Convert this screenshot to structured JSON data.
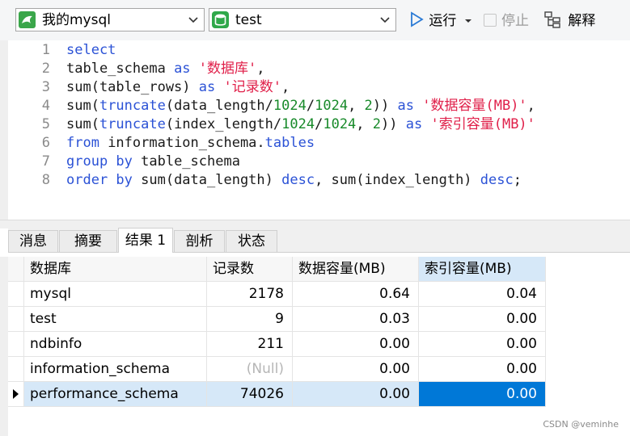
{
  "toolbar": {
    "connection": "我的mysql",
    "database": "test",
    "run_label": "运行",
    "stop_label": "停止",
    "explain_label": "解释"
  },
  "editor": {
    "line_numbers": [
      "1",
      "2",
      "3",
      "4",
      "5",
      "6",
      "7",
      "8"
    ],
    "lines": [
      [
        {
          "t": "select",
          "c": "kw"
        }
      ],
      [
        {
          "t": "table_schema ",
          "c": ""
        },
        {
          "t": "as",
          "c": "kw"
        },
        {
          "t": " ",
          "c": ""
        },
        {
          "t": "'数据库'",
          "c": "str"
        },
        {
          "t": ",",
          "c": ""
        }
      ],
      [
        {
          "t": "sum(table_rows) ",
          "c": ""
        },
        {
          "t": "as",
          "c": "kw"
        },
        {
          "t": " ",
          "c": ""
        },
        {
          "t": "'记录数'",
          "c": "str"
        },
        {
          "t": ",",
          "c": ""
        }
      ],
      [
        {
          "t": "sum(",
          "c": ""
        },
        {
          "t": "truncate",
          "c": "fn"
        },
        {
          "t": "(data_length/",
          "c": ""
        },
        {
          "t": "1024",
          "c": "num"
        },
        {
          "t": "/",
          "c": ""
        },
        {
          "t": "1024",
          "c": "num"
        },
        {
          "t": ", ",
          "c": ""
        },
        {
          "t": "2",
          "c": "num"
        },
        {
          "t": ")) ",
          "c": ""
        },
        {
          "t": "as",
          "c": "kw"
        },
        {
          "t": " ",
          "c": ""
        },
        {
          "t": "'数据容量(MB)'",
          "c": "str"
        },
        {
          "t": ",",
          "c": ""
        }
      ],
      [
        {
          "t": "sum(",
          "c": ""
        },
        {
          "t": "truncate",
          "c": "fn"
        },
        {
          "t": "(index_length/",
          "c": ""
        },
        {
          "t": "1024",
          "c": "num"
        },
        {
          "t": "/",
          "c": ""
        },
        {
          "t": "1024",
          "c": "num"
        },
        {
          "t": ", ",
          "c": ""
        },
        {
          "t": "2",
          "c": "num"
        },
        {
          "t": ")) ",
          "c": ""
        },
        {
          "t": "as",
          "c": "kw"
        },
        {
          "t": " ",
          "c": ""
        },
        {
          "t": "'索引容量(MB)'",
          "c": "str"
        }
      ],
      [
        {
          "t": "from",
          "c": "kw"
        },
        {
          "t": " information_schema.",
          "c": ""
        },
        {
          "t": "tables",
          "c": "kw"
        }
      ],
      [
        {
          "t": "group by",
          "c": "kw"
        },
        {
          "t": " table_schema",
          "c": ""
        }
      ],
      [
        {
          "t": "order by",
          "c": "kw"
        },
        {
          "t": " sum(data_length) ",
          "c": ""
        },
        {
          "t": "desc",
          "c": "kw"
        },
        {
          "t": ", sum(index_length) ",
          "c": ""
        },
        {
          "t": "desc",
          "c": "kw"
        },
        {
          "t": ";",
          "c": ""
        }
      ]
    ]
  },
  "tabs": [
    "消息",
    "摘要",
    "结果 1",
    "剖析",
    "状态"
  ],
  "results": {
    "columns": [
      "数据库",
      "记录数",
      "数据容量(MB)",
      "索引容量(MB)"
    ],
    "rows": [
      [
        "mysql",
        "2178",
        "0.64",
        "0.04"
      ],
      [
        "test",
        "9",
        "0.03",
        "0.00"
      ],
      [
        "ndbinfo",
        "211",
        "0.00",
        "0.00"
      ],
      [
        "information_schema",
        "(Null)",
        "0.00",
        "0.00"
      ],
      [
        "performance_schema",
        "74026",
        "0.00",
        "0.00"
      ]
    ]
  },
  "watermark": "CSDN @veminhe"
}
